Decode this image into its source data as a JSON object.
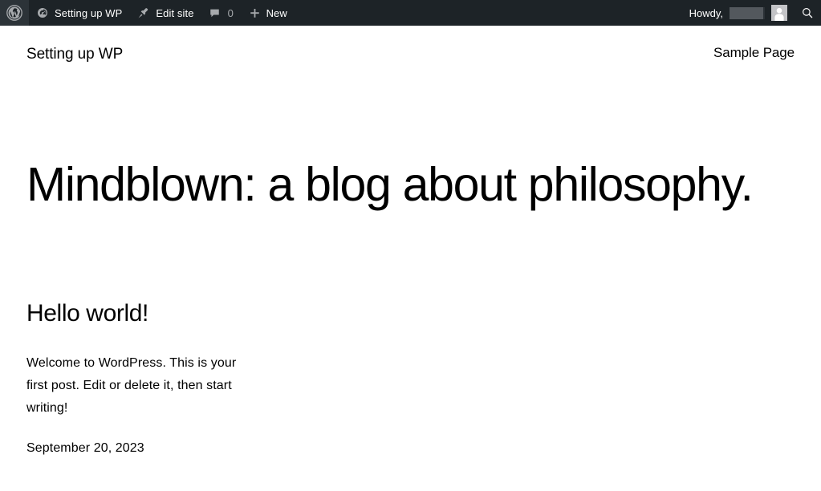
{
  "admin_bar": {
    "background_color": "#1d2327",
    "logo": {
      "icon": "wordpress-logo-icon",
      "label": "About WordPress"
    },
    "items": [
      {
        "icon": "dashboard-speedometer-icon",
        "label": "Setting up WP"
      },
      {
        "icon": "pin-edit-site-icon",
        "label": "Edit site"
      }
    ],
    "comments": {
      "icon": "comment-bubble-icon",
      "count": "0"
    },
    "new": {
      "icon": "plus-icon",
      "label": "New"
    },
    "account": {
      "greeting": "Howdy,",
      "username_redacted": true,
      "avatar_icon": "user-avatar-icon"
    },
    "search": {
      "icon": "search-magnifier-icon"
    }
  },
  "site_header": {
    "title": "Setting up WP",
    "nav": [
      {
        "label": "Sample Page"
      }
    ]
  },
  "main": {
    "hero_title": "Mindblown: a blog about philosophy.",
    "posts": [
      {
        "title": "Hello world!",
        "excerpt": "Welcome to WordPress. This is your first post. Edit or delete it, then start writing!",
        "date": "September 20, 2023"
      }
    ]
  },
  "colors": {
    "admin_bar_bg": "#1d2327",
    "admin_bar_text": "#ffffff",
    "admin_bar_muted": "#a7aaad",
    "page_bg": "#ffffff",
    "body_text": "#000000"
  }
}
